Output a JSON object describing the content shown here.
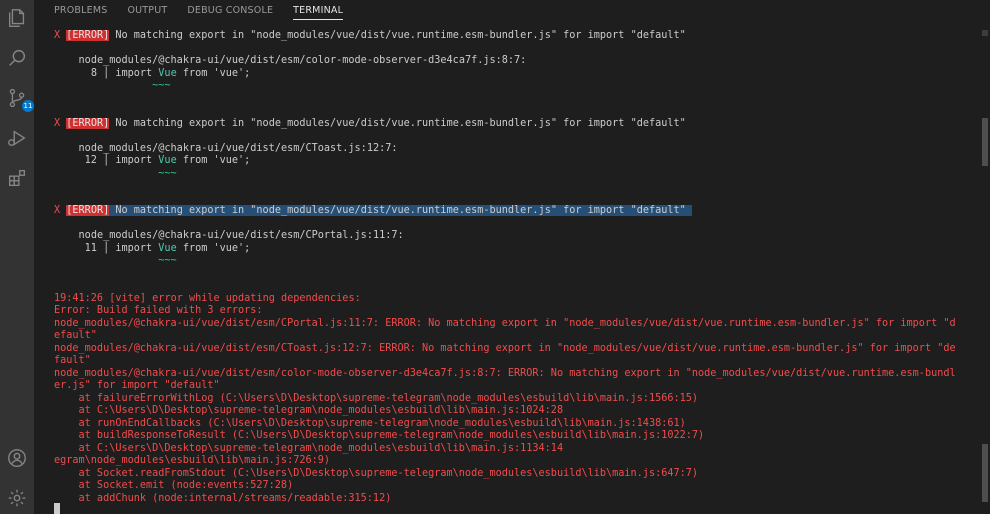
{
  "tabs": [
    {
      "label": "PROBLEMS",
      "active": false
    },
    {
      "label": "OUTPUT",
      "active": false
    },
    {
      "label": "DEBUG CONSOLE",
      "active": false
    },
    {
      "label": "TERMINAL",
      "active": true
    }
  ],
  "activity": {
    "scm_badge": "11"
  },
  "colors": {
    "error_red": "#f14c4c",
    "badge_bg": "#cd3131",
    "selection": "#264f78",
    "accent": "#007acc"
  },
  "terminal": {
    "error_x": "X",
    "error_tag": "[ERROR]",
    "error_msg": "No matching export in \"node_modules/vue/dist/vue.runtime.esm-bundler.js\" for import \"default\"",
    "blocks": [
      {
        "path": "node_modules/@chakra-ui/vue/dist/esm/color-mode-observer-d3e4ca7f.js:8:7:",
        "lineno": "8",
        "code_pre": "import ",
        "code_kw": "Vue",
        "code_post": " from 'vue';",
        "squiggle": "~~~"
      },
      {
        "path": "node_modules/@chakra-ui/vue/dist/esm/CToast.js:12:7:",
        "lineno": "12",
        "code_pre": "import ",
        "code_kw": "Vue",
        "code_post": " from 'vue';",
        "squiggle": "~~~"
      },
      {
        "path": "node_modules/@chakra-ui/vue/dist/esm/CPortal.js:11:7:",
        "lineno": "11",
        "code_pre": "import ",
        "code_kw": "Vue",
        "code_post": " from 'vue';",
        "squiggle": "~~~"
      }
    ],
    "vite_time": "19:41:26",
    "vite_tag": "[vite]",
    "vite_msg": "error while updating dependencies:",
    "summary": [
      "Error: Build failed with 3 errors:",
      "node_modules/@chakra-ui/vue/dist/esm/CPortal.js:11:7: ERROR: No matching export in \"node_modules/vue/dist/vue.runtime.esm-bundler.js\" for import \"d",
      "efault\"",
      "node_modules/@chakra-ui/vue/dist/esm/CToast.js:12:7: ERROR: No matching export in \"node_modules/vue/dist/vue.runtime.esm-bundler.js\" for import \"de",
      "fault\"",
      "node_modules/@chakra-ui/vue/dist/esm/color-mode-observer-d3e4ca7f.js:8:7: ERROR: No matching export in \"node_modules/vue/dist/vue.runtime.esm-bundl",
      "er.js\" for import \"default\"",
      "    at failureErrorWithLog (C:\\Users\\D\\Desktop\\supreme-telegram\\node_modules\\esbuild\\lib\\main.js:1566:15)",
      "    at C:\\Users\\D\\Desktop\\supreme-telegram\\node_modules\\esbuild\\lib\\main.js:1024:28",
      "    at runOnEndCallbacks (C:\\Users\\D\\Desktop\\supreme-telegram\\node_modules\\esbuild\\lib\\main.js:1438:61)",
      "    at buildResponseToResult (C:\\Users\\D\\Desktop\\supreme-telegram\\node_modules\\esbuild\\lib\\main.js:1022:7)",
      "    at C:\\Users\\D\\Desktop\\supreme-telegram\\node_modules\\esbuild\\lib\\main.js:1134:14",
      "egram\\node_modules\\esbuild\\lib\\main.js:726:9)",
      "    at Socket.readFromStdout (C:\\Users\\D\\Desktop\\supreme-telegram\\node_modules\\esbuild\\lib\\main.js:647:7)",
      "    at Socket.emit (node:events:527:28)",
      "    at addChunk (node:internal/streams/readable:315:12)"
    ]
  }
}
